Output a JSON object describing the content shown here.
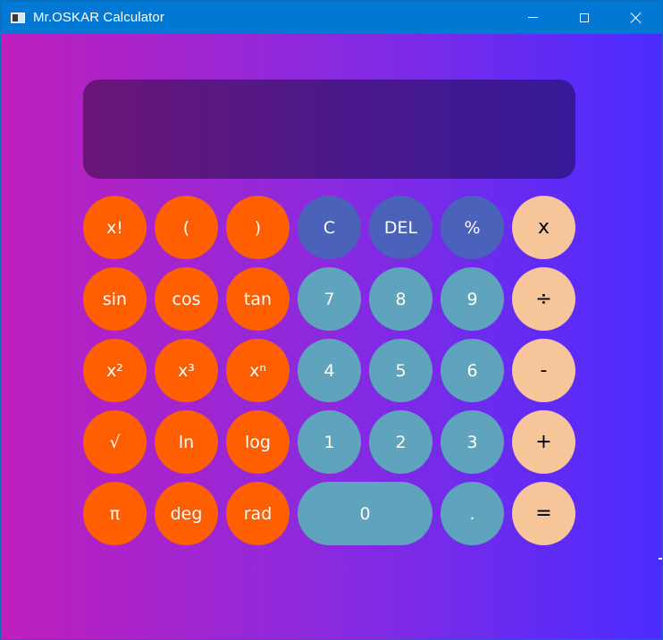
{
  "window": {
    "title": "Mr.OSKAR Calculator",
    "controls": {
      "minimize": "minimize-icon",
      "maximize": "maximize-icon",
      "close": "close-icon"
    }
  },
  "display": {
    "value": ""
  },
  "keys": {
    "factorial": "x!",
    "open_paren": "(",
    "close_paren": ")",
    "clear": "C",
    "delete": "DEL",
    "percent": "%",
    "multiply": "x",
    "sin": "sin",
    "cos": "cos",
    "tan": "tan",
    "seven": "7",
    "eight": "8",
    "nine": "9",
    "divide": "÷",
    "square": "x²",
    "cube": "x³",
    "power": "xⁿ",
    "four": "4",
    "five": "5",
    "six": "6",
    "subtract": "-",
    "sqrt": "√",
    "ln": "ln",
    "log": "log",
    "one": "1",
    "two": "2",
    "three": "3",
    "add": "+",
    "pi": "π",
    "deg": "deg",
    "rad": "rad",
    "zero": "0",
    "decimal": ".",
    "equals": "="
  },
  "colors": {
    "titlebar": "#0078d4",
    "background_start": "#bf1fbc",
    "background_end": "#4b2cff",
    "display_start": "#6a1577",
    "display_end": "#361a98",
    "function_key": "#ff5f00",
    "control_key": "#4b62bb",
    "number_key": "#5fa3bc",
    "operator_key": "#f6c59a"
  }
}
